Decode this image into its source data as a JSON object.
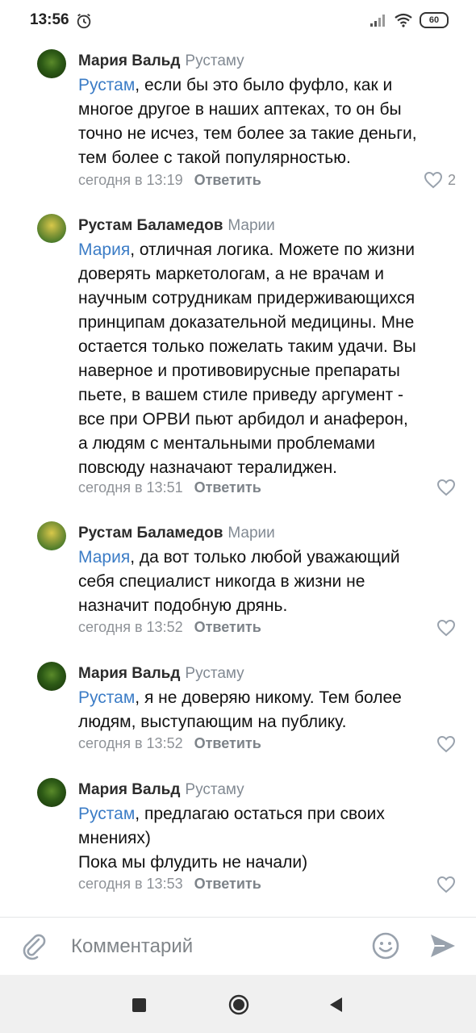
{
  "status": {
    "time": "13:56",
    "battery": "60"
  },
  "comments": [
    {
      "author": "Мария Вальд",
      "reply_to": "Рустаму",
      "mention": "Рустам",
      "lines": [
        ", если бы это было фуфло, как и",
        "многое другое в наших аптеках, то он бы",
        "точно не исчез, тем более за такие деньги,",
        "тем более с такой популярностью."
      ],
      "time": "сегодня в 13:19",
      "reply_label": "Ответить",
      "likes": "2"
    },
    {
      "author": "Рустам Баламедов",
      "reply_to": "Марии",
      "mention": "Мария",
      "lines": [
        ", отличная логика. Можете по жизни",
        "доверять маркетологам, а не врачам и",
        "научным сотрудникам придерживающихся",
        "принципам доказательной медицины. Мне",
        "остается только пожелать таким удачи. Вы",
        "наверное и противовирусные препараты",
        "пьете, в вашем стиле приведу аргумент -",
        "все при ОРВИ пьют арбидол и анаферон,",
        "а людям с ментальными проблемами",
        "повсюду назначают тералиджен."
      ],
      "time": "сегодня в 13:51",
      "reply_label": "Ответить",
      "likes": ""
    },
    {
      "author": "Рустам Баламедов",
      "reply_to": "Марии",
      "mention": "Мария",
      "lines": [
        ", да вот только любой уважающий",
        "себя специалист никогда в жизни не",
        "назначит подобную дрянь."
      ],
      "time": "сегодня в 13:52",
      "reply_label": "Ответить",
      "likes": ""
    },
    {
      "author": "Мария Вальд",
      "reply_to": "Рустаму",
      "mention": "Рустам",
      "lines": [
        ", я не доверяю никому. Тем более",
        "людям, выступающим на публику."
      ],
      "time": "сегодня в 13:52",
      "reply_label": "Ответить",
      "likes": ""
    },
    {
      "author": "Мария Вальд",
      "reply_to": "Рустаму",
      "mention": "Рустам",
      "lines": [
        ", предлагаю остаться при своих",
        "мнениях)",
        "Пока мы флудить не начали)"
      ],
      "time": "сегодня в 13:53",
      "reply_label": "Ответить",
      "likes": ""
    }
  ],
  "composer": {
    "placeholder": "Комментарий"
  },
  "colors": {
    "mention": "#3b7cc6",
    "meta": "#8e9297",
    "accent": "#5181b8"
  }
}
